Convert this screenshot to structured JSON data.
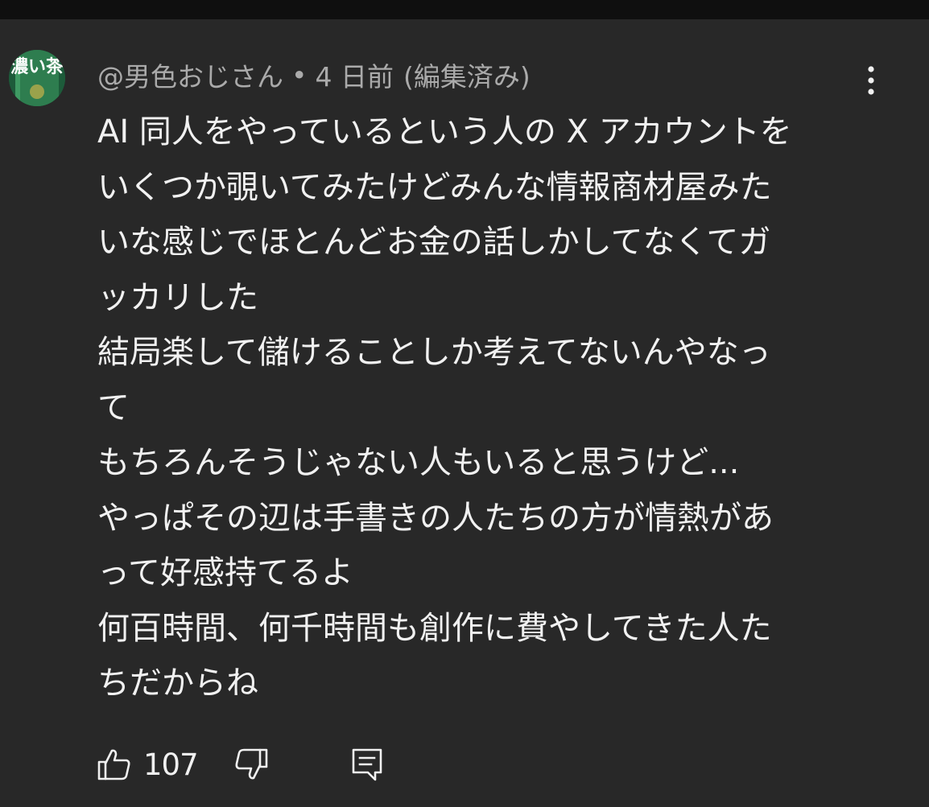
{
  "comment": {
    "avatar": {
      "icon": "tea-can-avatar",
      "text": "濃い茶",
      "color": "#1d5b3a"
    },
    "author": "@男色おじさん",
    "separator": "•",
    "timestamp": "4 日前",
    "edited": "(編集済み)",
    "body_lines": [
      "AI 同人をやっているという人の X アカウントを",
      "いくつか覗いてみたけどみんな情報商材屋みた",
      "いな感じでほとんどお金の話しかしてなくてガ",
      "ッカリした",
      "結局楽して儲けることしか考えてないんやなっ",
      "て",
      "もちろんそうじゃない人もいると思うけど...",
      "やっぱその辺は手書きの人たちの方が情熱があ",
      "って好感持てるよ",
      "何百時間、何千時間も創作に費やしてきた人た",
      "ちだからね"
    ],
    "like_count": "107"
  },
  "icons": {
    "more": "more-vert-icon",
    "like": "thumbs-up-icon",
    "dislike": "thumbs-down-icon",
    "reply": "reply-comment-icon"
  },
  "colors": {
    "background": "#282828",
    "top_bar": "#0f0f0f",
    "text": "#f1f1f1",
    "meta_text": "#aaaaaa"
  }
}
